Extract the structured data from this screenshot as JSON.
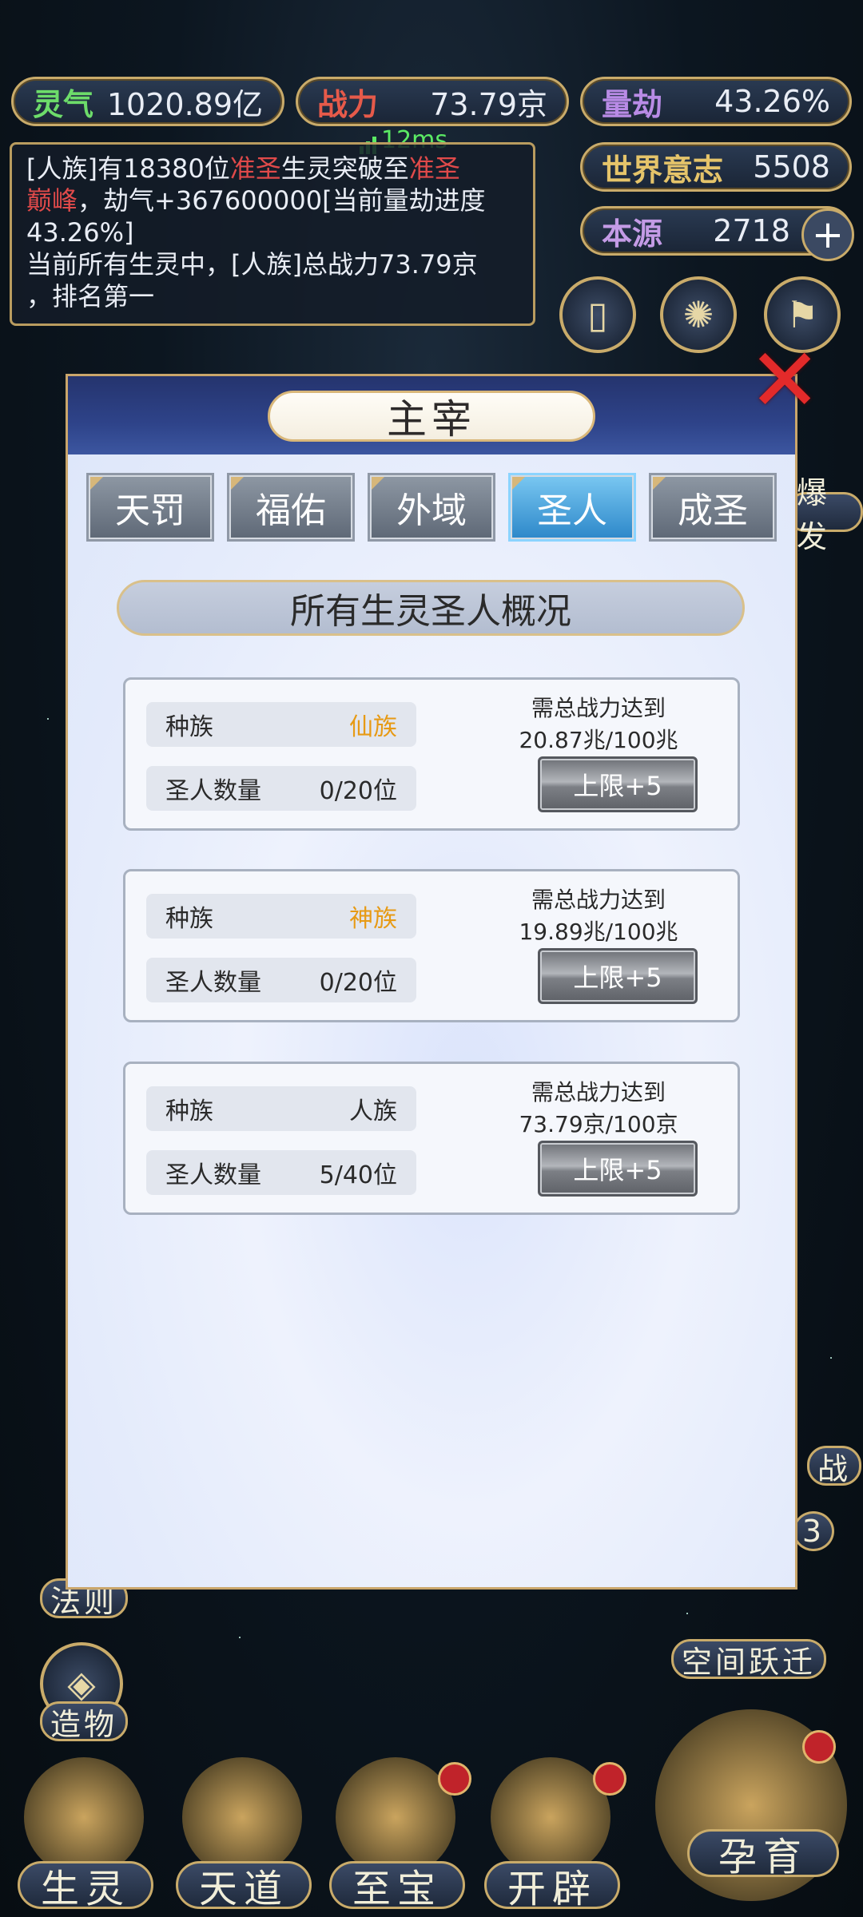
{
  "stats": {
    "lingqi": {
      "label": "灵气",
      "value": "1020.89亿"
    },
    "zhanli": {
      "label": "战力",
      "value": "73.79京"
    },
    "liangjie": {
      "label": "量劫",
      "value": "43.26%"
    },
    "world_will": {
      "label": "世界意志",
      "value": "5508"
    },
    "origin": {
      "label": "本源",
      "value": "2718"
    }
  },
  "ping": "12ms",
  "log": {
    "line1_a": "[人族]有18380位",
    "line1_red": "准圣",
    "line1_b": "生灵突破至",
    "line1_red2": "准圣",
    "line2_red": "巅峰",
    "line2_b": "，劫气+367600000[当前量劫进度",
    "line3": "43.26%]",
    "line4": "当前所有生灵中，[人族]总战力73.79京",
    "line5": "，排名第一"
  },
  "dialog": {
    "title": "主宰",
    "tabs": [
      "天罚",
      "福佑",
      "外域",
      "圣人",
      "成圣"
    ],
    "active_tab": "圣人",
    "section_title": "所有生灵圣人概况",
    "cards": [
      {
        "race_label": "种族",
        "race": "仙族",
        "race_color": "#e79a14",
        "count_label": "圣人数量",
        "count": "0/20位",
        "req_label": "需总战力达到",
        "req_value": "20.87兆/100兆",
        "button": "上限+5"
      },
      {
        "race_label": "种族",
        "race": "神族",
        "race_color": "#e79a14",
        "count_label": "圣人数量",
        "count": "0/20位",
        "req_label": "需总战力达到",
        "req_value": "19.89兆/100兆",
        "button": "上限+5"
      },
      {
        "race_label": "种族",
        "race": "人族",
        "race_color": "#2a2a2a",
        "count_label": "圣人数量",
        "count": "5/40位",
        "req_label": "需总战力达到",
        "req_value": "73.79京/100京",
        "button": "上限+5"
      }
    ]
  },
  "side": {
    "right_top": "爆发",
    "right_mid": "战",
    "right_badge": "3",
    "left_law": "法则",
    "left_create": "造物",
    "right_space": "空间跃迁"
  },
  "bottom_nav": [
    "生灵",
    "天道",
    "至宝",
    "开辟"
  ],
  "main_button": "孕育"
}
